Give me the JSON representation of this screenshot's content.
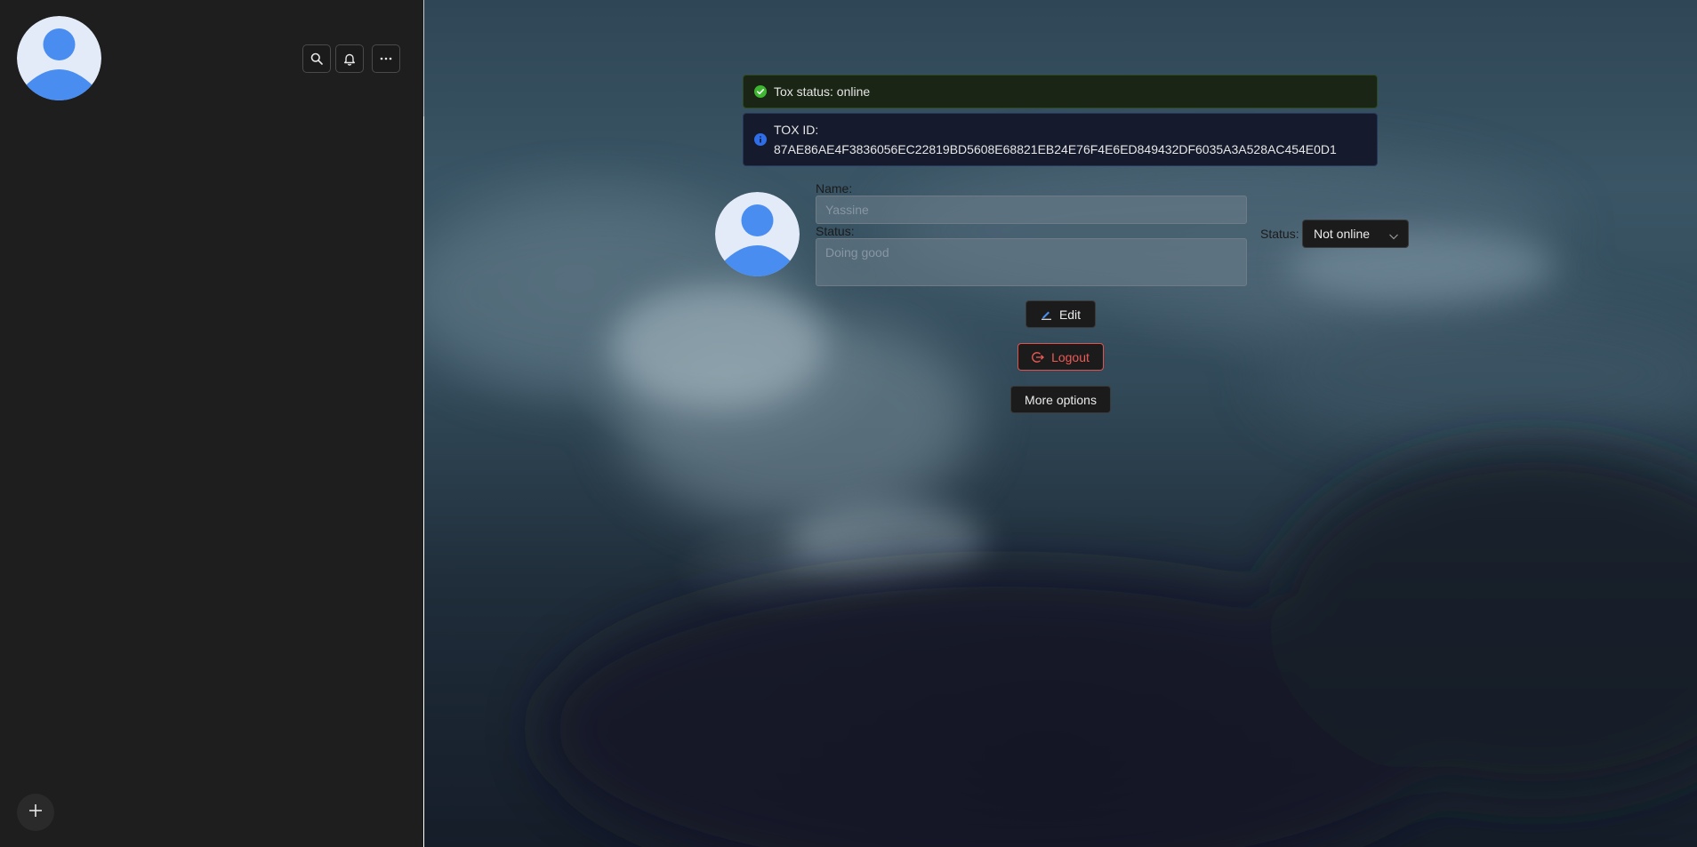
{
  "sidebar": {
    "avatar": {
      "icon": "user-avatar-icon"
    },
    "actions": [
      {
        "name": "search-button",
        "icon": "search-icon"
      },
      {
        "name": "notifications-button",
        "icon": "bell-icon"
      },
      {
        "name": "more-menu-button",
        "icon": "ellipsis-icon"
      }
    ],
    "add_button": {
      "icon": "plus-icon"
    }
  },
  "banners": {
    "online": {
      "text": "Tox status: online",
      "icon": "check-circle-icon",
      "color": "#3fb631"
    },
    "tox_id": {
      "label": "TOX ID:",
      "value": "87AE86AE4F3836056EC22819BD5608E68821EB24E76F4E6ED849432DF6035A3A528AC454E0D1",
      "icon": "info-circle-icon",
      "color": "#2f6ee6"
    }
  },
  "profile": {
    "name_label": "Name:",
    "name_placeholder": "Yassine",
    "status_label": "Status:",
    "status_placeholder": "Doing good",
    "presence_label": "Status:",
    "presence_value": "Not online"
  },
  "actions": {
    "edit_label": "Edit",
    "logout_label": "Logout",
    "more_label": "More options",
    "logout_color": "#ef5a55"
  }
}
